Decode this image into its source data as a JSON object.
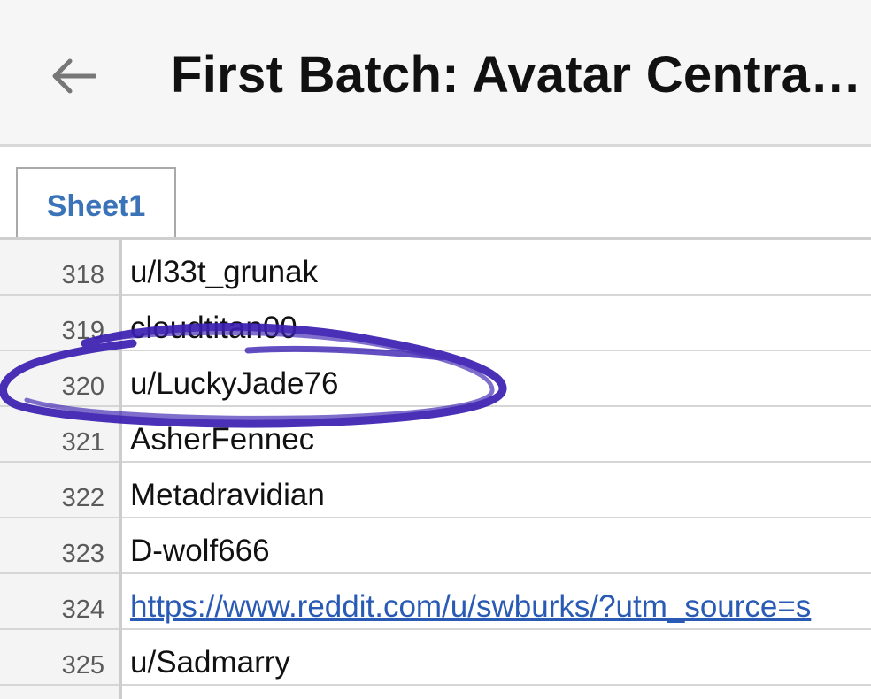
{
  "header": {
    "title": "First Batch: Avatar Centra…",
    "back_icon": "arrow-left-icon"
  },
  "tabs": [
    {
      "label": "Sheet1",
      "active": true
    }
  ],
  "rows": [
    {
      "number": "318",
      "value": "u/l33t_grunak",
      "is_link": false
    },
    {
      "number": "319",
      "value": "cloudtitan00",
      "is_link": false
    },
    {
      "number": "320",
      "value": "u/LuckyJade76",
      "is_link": false
    },
    {
      "number": "321",
      "value": "AsherFennec",
      "is_link": false
    },
    {
      "number": "322",
      "value": "Metadravidian",
      "is_link": false
    },
    {
      "number": "323",
      "value": "D-wolf666",
      "is_link": false
    },
    {
      "number": "324",
      "value": "https://www.reddit.com/u/swburks/?utm_source=s",
      "is_link": true
    },
    {
      "number": "325",
      "value": "u/Sadmarry",
      "is_link": false
    }
  ],
  "colors": {
    "tab_label": "#3a73b8",
    "link": "#2a5bb4",
    "annotation_ink": "#3a1fb0"
  }
}
